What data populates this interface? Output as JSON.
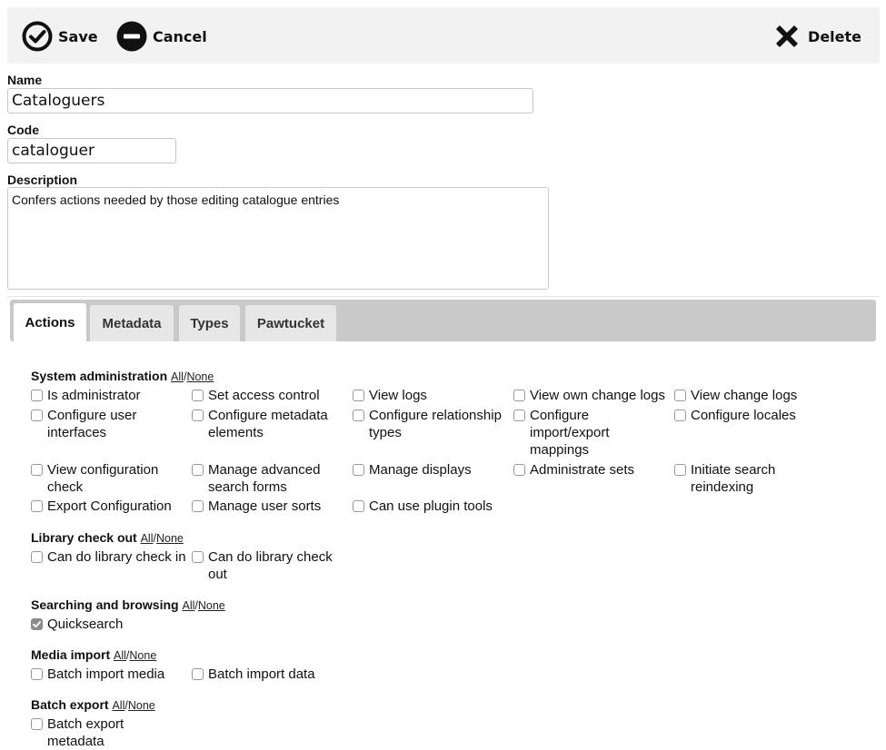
{
  "toolbar": {
    "save_label": "Save",
    "cancel_label": "Cancel",
    "delete_label": "Delete"
  },
  "form": {
    "name_label": "Name",
    "name_value": "Cataloguers",
    "code_label": "Code",
    "code_value": "cataloguer",
    "description_label": "Description",
    "description_value": "Confers actions needed by those editing catalogue entries"
  },
  "tabs": [
    {
      "label": "Actions",
      "active": true
    },
    {
      "label": "Metadata",
      "active": false
    },
    {
      "label": "Types",
      "active": false
    },
    {
      "label": "Pawtucket",
      "active": false
    }
  ],
  "links": {
    "all": "All",
    "sep": "/",
    "none": "None"
  },
  "sections": [
    {
      "title": "System administration",
      "items": [
        {
          "label": "Is administrator",
          "checked": false
        },
        {
          "label": "Set access control",
          "checked": false
        },
        {
          "label": "View logs",
          "checked": false
        },
        {
          "label": "View own change logs",
          "checked": false
        },
        {
          "label": "View change logs",
          "checked": false
        },
        {
          "label": "Configure user interfaces",
          "checked": false
        },
        {
          "label": "Configure metadata elements",
          "checked": false
        },
        {
          "label": "Configure relationship types",
          "checked": false
        },
        {
          "label": "Configure import/export mappings",
          "checked": false
        },
        {
          "label": "Configure locales",
          "checked": false
        },
        {
          "label": "View configuration check",
          "checked": false
        },
        {
          "label": "Manage advanced search forms",
          "checked": false
        },
        {
          "label": "Manage displays",
          "checked": false
        },
        {
          "label": "Administrate sets",
          "checked": false
        },
        {
          "label": "Initiate search reindexing",
          "checked": false
        },
        {
          "label": "Export Configuration",
          "checked": false
        },
        {
          "label": "Manage user sorts",
          "checked": false
        },
        {
          "label": "Can use plugin tools",
          "checked": false
        }
      ]
    },
    {
      "title": "Library check out",
      "items": [
        {
          "label": "Can do library check in",
          "checked": false
        },
        {
          "label": "Can do library check out",
          "checked": false
        }
      ]
    },
    {
      "title": "Searching and browsing",
      "items": [
        {
          "label": "Quicksearch",
          "checked": true
        }
      ]
    },
    {
      "title": "Media import",
      "items": [
        {
          "label": "Batch import media",
          "checked": false
        },
        {
          "label": "Batch import data",
          "checked": false
        }
      ]
    },
    {
      "title": "Batch export",
      "items": [
        {
          "label": "Batch export metadata",
          "checked": false
        }
      ]
    }
  ]
}
